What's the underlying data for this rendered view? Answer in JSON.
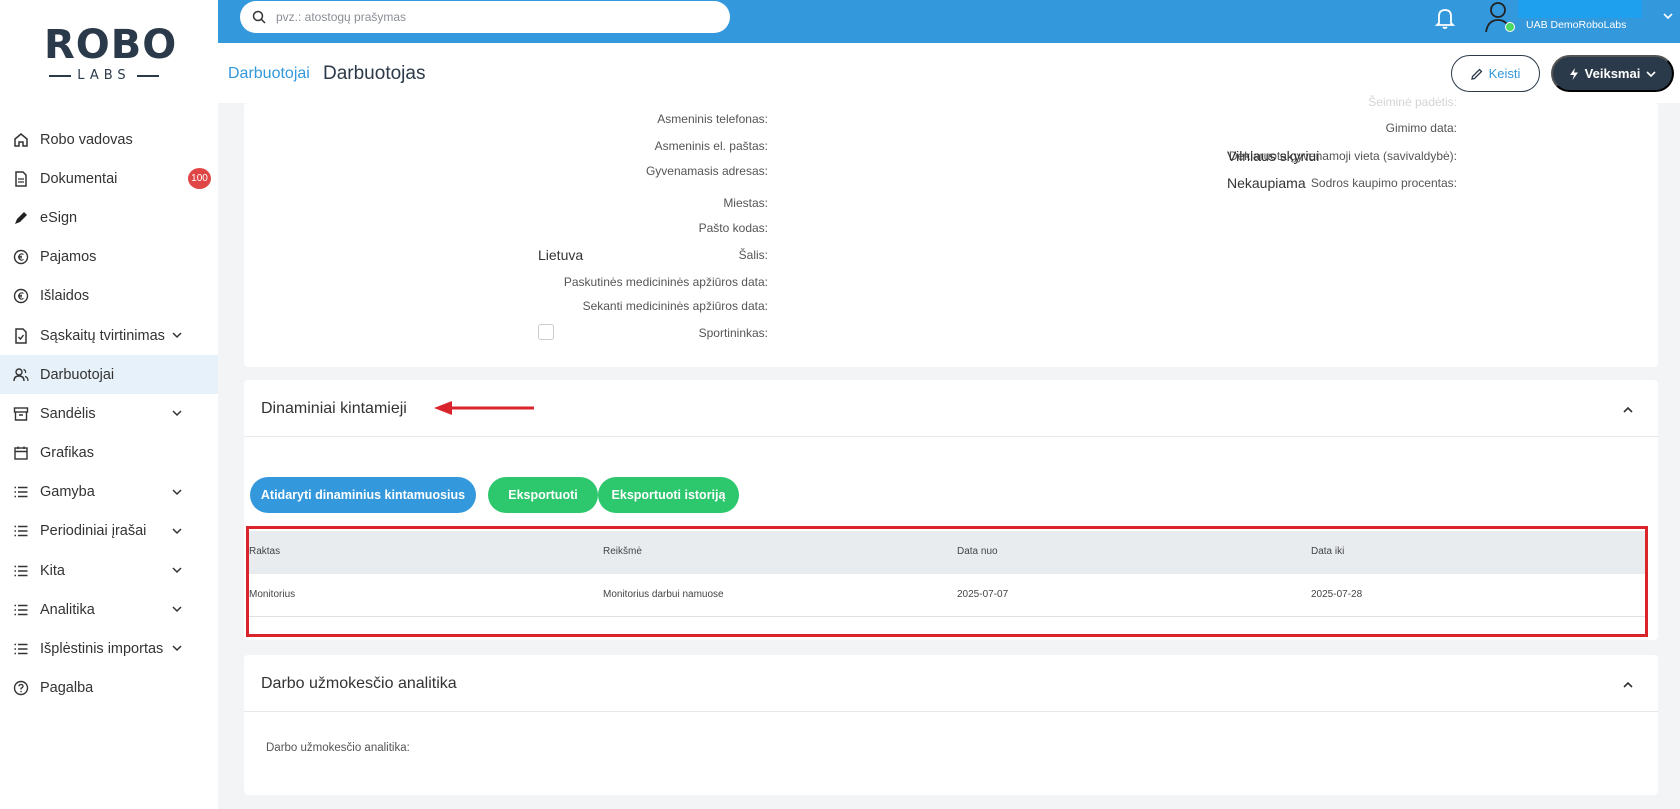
{
  "brand": {
    "logo_top": "ROBO",
    "logo_bottom": "LABS"
  },
  "search": {
    "placeholder": "pvz.: atostogų prašymas"
  },
  "user": {
    "company": "UAB DemoRoboLabs"
  },
  "header": {
    "breadcrumb": "Darbuotojai",
    "title": "Darbuotojas",
    "edit_label": "Keisti",
    "actions_label": "Veiksmai"
  },
  "sidebar": {
    "items": [
      {
        "label": "Robo vadovas",
        "icon": "home-icon"
      },
      {
        "label": "Dokumentai",
        "icon": "document-icon",
        "badge": "100"
      },
      {
        "label": "eSign",
        "icon": "pen-icon"
      },
      {
        "label": "Pajamos",
        "icon": "euro-in-icon"
      },
      {
        "label": "Išlaidos",
        "icon": "euro-out-icon"
      },
      {
        "label": "Sąskaitų tvirtinimas",
        "icon": "invoice-check-icon",
        "expandable": true
      },
      {
        "label": "Darbuotojai",
        "icon": "users-icon",
        "active": true
      },
      {
        "label": "Sandėlis",
        "icon": "warehouse-icon",
        "expandable": true
      },
      {
        "label": "Grafikas",
        "icon": "calendar-icon"
      },
      {
        "label": "Gamyba",
        "icon": "list-icon",
        "expandable": true
      },
      {
        "label": "Periodiniai įrašai",
        "icon": "list-icon",
        "expandable": true
      },
      {
        "label": "Kita",
        "icon": "list-icon",
        "expandable": true
      },
      {
        "label": "Analitika",
        "icon": "list-icon",
        "expandable": true
      },
      {
        "label": "Išplėstinis importas",
        "icon": "list-icon",
        "expandable": true
      },
      {
        "label": "Pagalba",
        "icon": "help-icon"
      }
    ]
  },
  "personal": {
    "left": [
      {
        "label": "Asmeninis telefonas:",
        "value": ""
      },
      {
        "label": "Asmeninis el. paštas:",
        "value": ""
      },
      {
        "label": "Gyvenamasis adresas:",
        "value": ""
      },
      {
        "label": "Miestas:",
        "value": ""
      },
      {
        "label": "Pašto kodas:",
        "value": ""
      },
      {
        "label": "Šalis:",
        "value": "Lietuva"
      },
      {
        "label": "Paskutinės medicininės apžiūros data:",
        "value": ""
      },
      {
        "label": "Sekanti medicininės apžiūros data:",
        "value": ""
      },
      {
        "label": "Sportininkas:",
        "value": ""
      }
    ],
    "right": [
      {
        "label": "Šeiminė padėtis:",
        "value": ""
      },
      {
        "label": "Gimimo data:",
        "value": ""
      },
      {
        "label": "Deklaruota gyvenamoji vieta (savivaldybė):",
        "value": "Vilniaus skyriui"
      },
      {
        "label": "Sodros kaupimo procentas:",
        "value": "Nekaupiama"
      }
    ]
  },
  "dynamic": {
    "title": "Dinaminiai kintamieji",
    "btn_open": "Atidaryti dinaminius kintamuosius",
    "btn_export": "Eksportuoti",
    "btn_export_history": "Eksportuoti istoriją",
    "columns": [
      "Raktas",
      "Reikšmė",
      "Data nuo",
      "Data iki"
    ],
    "rows": [
      [
        "Monitorius",
        "Monitorius darbui namuose",
        "2025-07-07",
        "2025-07-28"
      ]
    ]
  },
  "payroll": {
    "title": "Darbo užmokesčio analitika",
    "label": "Darbo užmokesčio analitika:"
  },
  "colors": {
    "primary": "#3398dc",
    "green": "#2dc76d",
    "dark": "#2b3a4a",
    "highlight": "#d9242b"
  }
}
